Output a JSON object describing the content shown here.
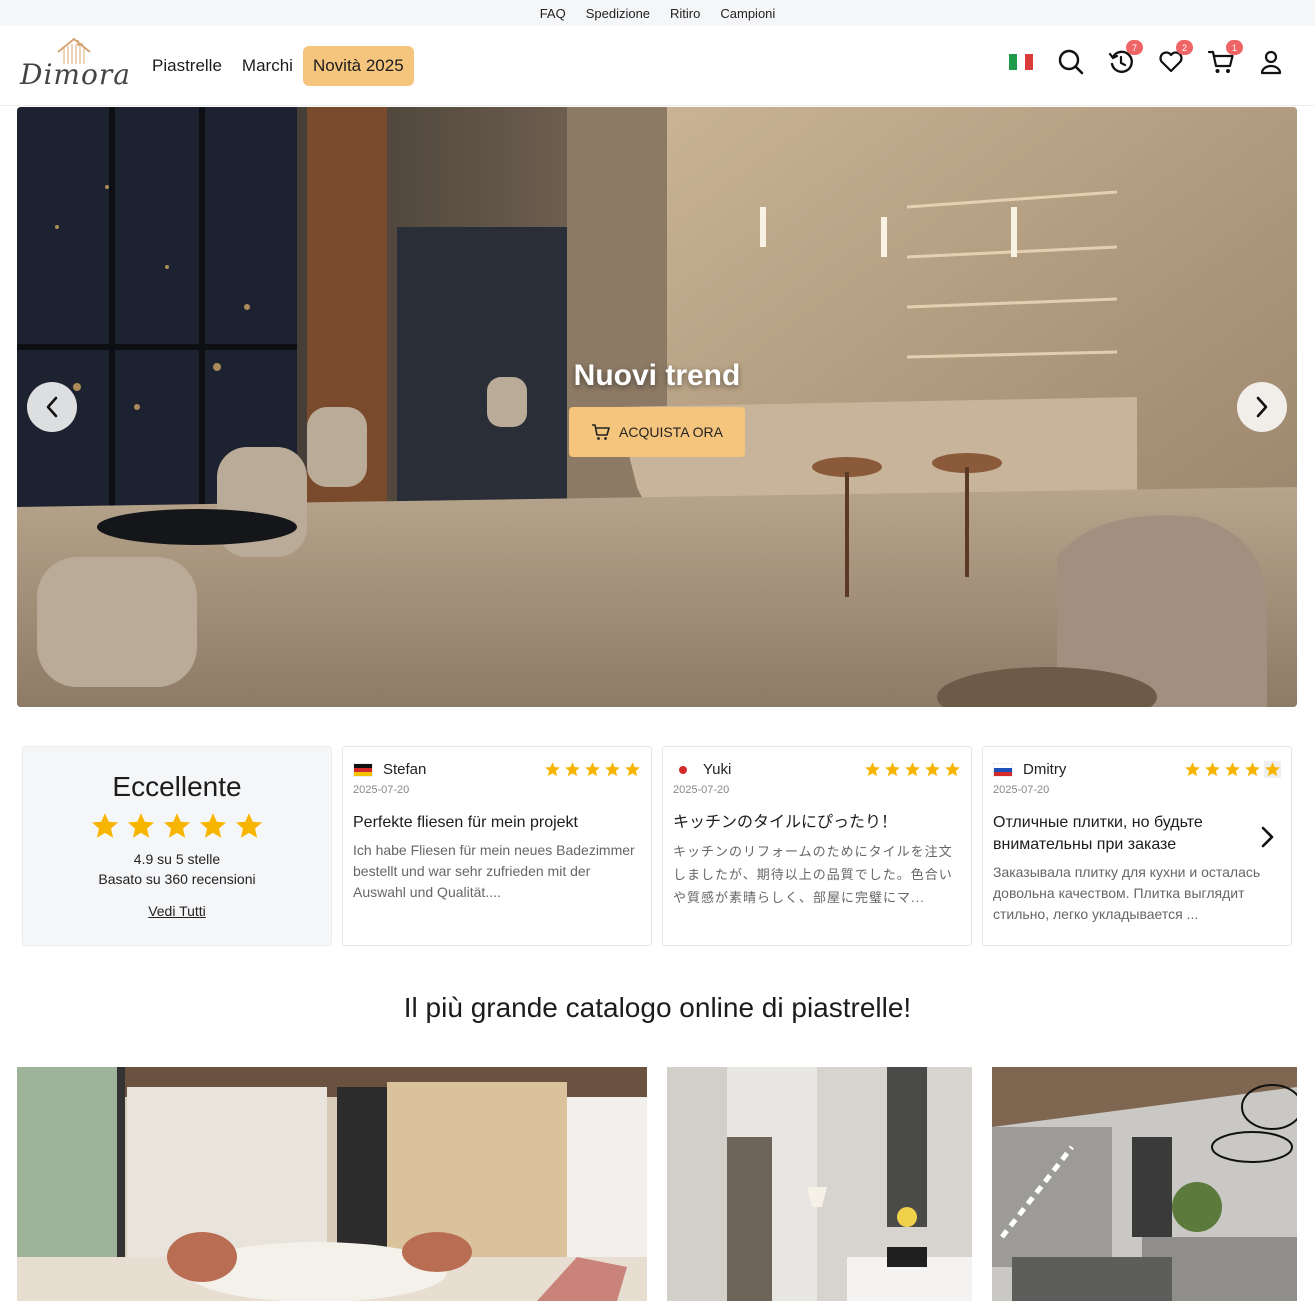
{
  "topbar": {
    "links": [
      "FAQ",
      "Spedizione",
      "Ritiro",
      "Campioni"
    ]
  },
  "header": {
    "logo_text": "Dimora",
    "nav": [
      "Piastrelle",
      "Marchi",
      "Novità 2025"
    ],
    "badges": {
      "history": "7",
      "wishlist": "2",
      "cart": "1"
    },
    "icons": [
      "italy-flag-icon",
      "search-icon",
      "history-icon",
      "heart-icon",
      "cart-icon",
      "user-icon"
    ]
  },
  "hero": {
    "title": "Nuovi trend",
    "button_label": "ACQUISTA ORA"
  },
  "reviews_summary": {
    "title": "Eccellente",
    "rating_stars": 5,
    "score_text": "4.9 su 5 stelle",
    "count_text": "Basato su 360 recensioni",
    "link_text": "Vedi Tutti"
  },
  "reviews": [
    {
      "name": "Stefan",
      "country": "DE",
      "date": "2025-07-20",
      "stars": 5,
      "title": "Perfekte fliesen für mein projekt",
      "body": "Ich habe Fliesen für mein neues Badezimmer bestellt und war sehr zufrieden mit der Auswahl und Qualität...."
    },
    {
      "name": "Yuki",
      "country": "JP",
      "date": "2025-07-20",
      "stars": 5,
      "title": "キッチンのタイルにぴったり！",
      "body": "キッチンのリフォームのためにタイルを注文しましたが、期待以上の品質でした。色合いや質感が素晴らしく、部屋に完璧にマ..."
    },
    {
      "name": "Dmitry",
      "country": "RU",
      "date": "2025-07-20",
      "stars": 4.5,
      "title": "Отличные плитки, но будьте внимательны при заказе",
      "body": "Заказывала плитку для кухни и осталась довольна качеством. Плитка выглядит стильно, легко укладывается ..."
    }
  ],
  "catalog": {
    "title": "Il più grande catalogo online di piastrelle!"
  },
  "colors": {
    "accent": "#f5c47d",
    "star": "#f7b500",
    "badge": "#ef6464",
    "topbar_bg": "#f5f6f8"
  }
}
